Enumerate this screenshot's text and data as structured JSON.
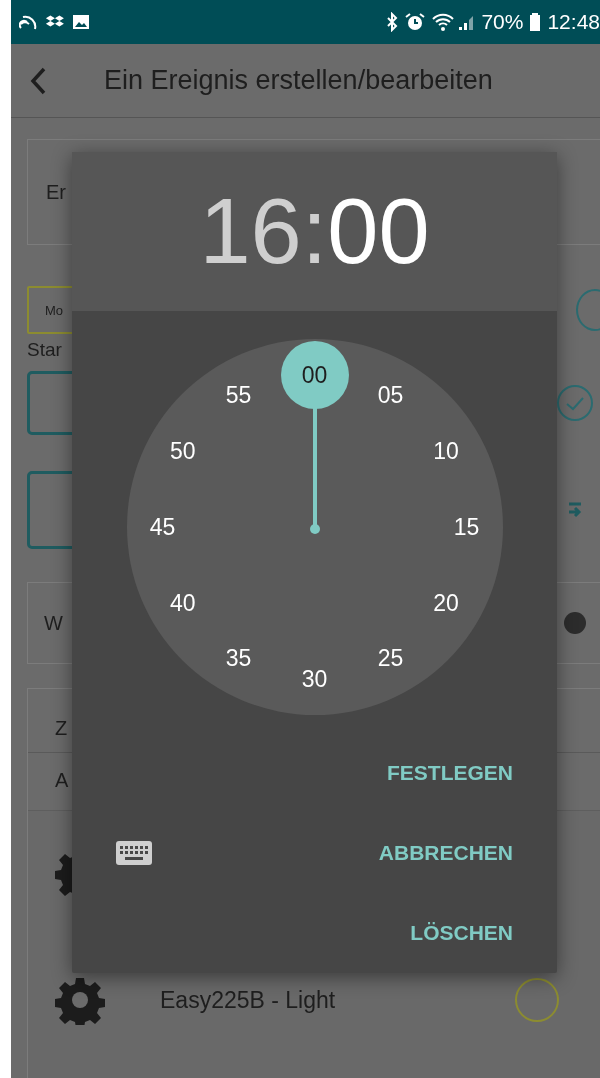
{
  "status_bar": {
    "battery": "70%",
    "time": "12:48"
  },
  "app_bar": {
    "title": "Ein Ereignis erstellen/bearbeiten"
  },
  "background": {
    "name_field": "Er",
    "mode_field": "Mo",
    "start_label": "Star",
    "weekday_row": "W",
    "section_title": "Z",
    "section_row": "A",
    "toggle": {
      "on": false
    }
  },
  "device": {
    "name": "Easy225B - Light",
    "checked": false
  },
  "time_picker": {
    "hours": {
      "text": "16",
      "selected": false
    },
    "separator": ":",
    "minutes": {
      "text": "00",
      "selected": true
    },
    "clock_marks": [
      {
        "label": "00",
        "selected": true
      },
      {
        "label": "05",
        "selected": false
      },
      {
        "label": "10",
        "selected": false
      },
      {
        "label": "15",
        "selected": false
      },
      {
        "label": "20",
        "selected": false
      },
      {
        "label": "25",
        "selected": false
      },
      {
        "label": "30",
        "selected": false
      },
      {
        "label": "35",
        "selected": false
      },
      {
        "label": "40",
        "selected": false
      },
      {
        "label": "45",
        "selected": false
      },
      {
        "label": "50",
        "selected": false
      },
      {
        "label": "55",
        "selected": false
      }
    ],
    "buttons": [
      "FESTLEGEN",
      "ABBRECHEN",
      "LÖSCHEN"
    ]
  }
}
